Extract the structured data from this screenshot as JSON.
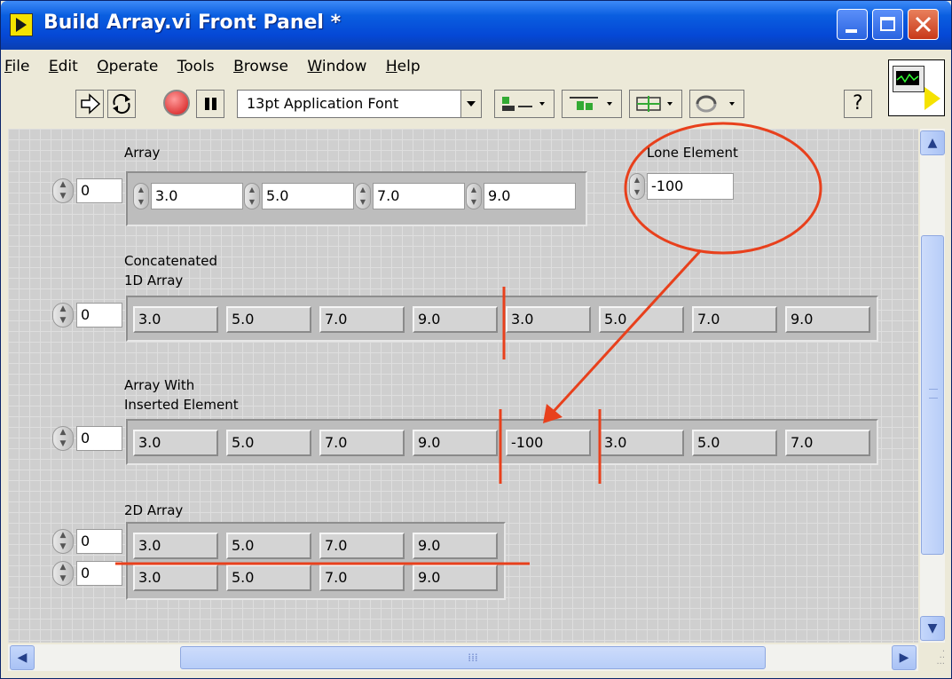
{
  "window": {
    "title": "Build Array.vi Front Panel *"
  },
  "menu": [
    "File",
    "Edit",
    "Operate",
    "Tools",
    "Browse",
    "Window",
    "Help"
  ],
  "toolbar": {
    "font_select": "13pt Application Font",
    "help_glyph": "?"
  },
  "panel": {
    "array": {
      "label": "Array",
      "index": "0",
      "values": [
        "3.0",
        "5.0",
        "7.0",
        "9.0"
      ]
    },
    "lone_element": {
      "label": "Lone Element",
      "value": "-100"
    },
    "concatenated": {
      "label_line1": "Concatenated",
      "label_line2": "1D Array",
      "index": "0",
      "values": [
        "3.0",
        "5.0",
        "7.0",
        "9.0",
        "3.0",
        "5.0",
        "7.0",
        "9.0"
      ]
    },
    "inserted": {
      "label_line1": "Array With",
      "label_line2": "Inserted Element",
      "index": "0",
      "values": [
        "3.0",
        "5.0",
        "7.0",
        "9.0",
        "-100",
        "3.0",
        "5.0",
        "7.0"
      ]
    },
    "array2d": {
      "label": "2D Array",
      "row_index": "0",
      "col_index": "0",
      "rows": [
        [
          "3.0",
          "5.0",
          "7.0",
          "9.0"
        ],
        [
          "3.0",
          "5.0",
          "7.0",
          "9.0"
        ]
      ]
    }
  },
  "annotation_color": "#e8401c"
}
